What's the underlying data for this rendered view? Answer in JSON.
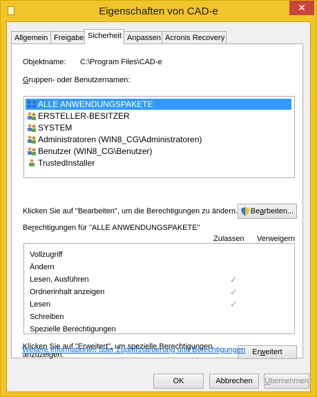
{
  "window": {
    "title": "Eigenschaften von CAD-e",
    "close_label": "✕"
  },
  "tabs": [
    {
      "label": "Allgemein"
    },
    {
      "label": "Freigabe"
    },
    {
      "label": "Sicherheit"
    },
    {
      "label": "Anpassen"
    },
    {
      "label": "Acronis Recovery"
    }
  ],
  "object": {
    "label": "Objektname:",
    "value": "C:\\Program Files\\CAD-e"
  },
  "groups": {
    "label_prefix": "G",
    "label_rest": "ruppen- oder Benutzernamen:",
    "items": [
      {
        "label": "ALLE ANWENDUNGSPAKETE",
        "selected": true
      },
      {
        "label": "ERSTELLER-BESITZER"
      },
      {
        "label": "SYSTEM"
      },
      {
        "label": "Administratoren (WIN8_CG\\Administratoren)"
      },
      {
        "label": "Benutzer (WIN8_CG\\Benutzer)"
      },
      {
        "label": "TrustedInstaller"
      }
    ]
  },
  "edit": {
    "hint": "Klicken Sie auf \"Bearbeiten\", um die Berechtigungen zu ändern.",
    "button_pre": "Be",
    "button_u": "a",
    "button_post": "rbeiten..."
  },
  "permissions": {
    "label_pre": "Be",
    "label_u": "r",
    "label_post": "echtigungen für \"ALLE ANWENDUNGSPAKETE\"",
    "col_allow": "Zulassen",
    "col_deny": "Verweigern",
    "rows": [
      {
        "label": "Vollzugriff",
        "allow": false
      },
      {
        "label": "Ändern",
        "allow": false
      },
      {
        "label": "Lesen, Ausführen",
        "allow": true
      },
      {
        "label": "Ordnerinhalt anzeigen",
        "allow": true
      },
      {
        "label": "Lesen",
        "allow": true
      },
      {
        "label": "Schreiben",
        "allow": false
      },
      {
        "label": "Spezielle Berechtigungen",
        "allow": false
      }
    ],
    "check_glyph": "✓"
  },
  "advanced": {
    "hint_line1": "Klicken Sie auf \"Erweitert\", um spezielle Berechtigungen",
    "hint_line2": "anzuzeigen.",
    "button_pre": "Er",
    "button_u": "w",
    "button_post": "eitert"
  },
  "more_info_link": "Weitere Informationen über Zugriffssteuerung und Berechtigungen",
  "footer": {
    "ok": "OK",
    "cancel": "Abbrechen",
    "apply_u": "Ü",
    "apply_post": "bernehmen"
  }
}
